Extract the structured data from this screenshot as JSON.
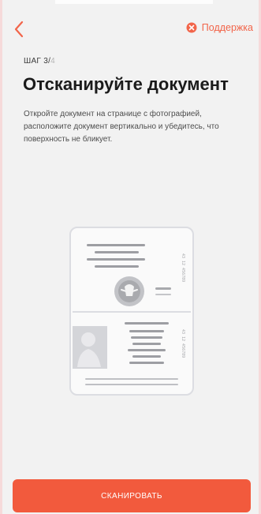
{
  "header": {
    "support_label": "Поддержка"
  },
  "step": {
    "label": "ШАГ 3/",
    "total": "4"
  },
  "title": "Отсканируйте документ",
  "description": "Откройте документ на странице с фотографией, расположите документ вертикально и убедитесь, что поверхность не бликует.",
  "action": {
    "scan_label": "СКАНИРОВАТЬ"
  },
  "icons": {
    "back": "chevron-left-icon",
    "support": "support-close-icon",
    "document": "passport-illustration"
  },
  "colors": {
    "accent": "#f25a3d",
    "background": "#f2f2f2",
    "title": "#1b1b1b",
    "muted": "#b5b5b5"
  }
}
